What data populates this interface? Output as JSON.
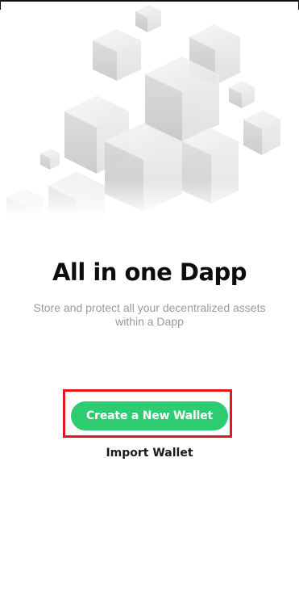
{
  "hero": {
    "image": "cubes-illustration"
  },
  "onboarding": {
    "title": "All in one Dapp",
    "subtitle": "Store and protect all your decentralized assets within a Dapp",
    "create_button_label": "Create a New Wallet",
    "import_label": "Import Wallet"
  },
  "colors": {
    "accent": "#2ecc71",
    "highlight": "#e3171c",
    "title": "#0d0d0d",
    "subtitle": "#9a9a9a"
  }
}
